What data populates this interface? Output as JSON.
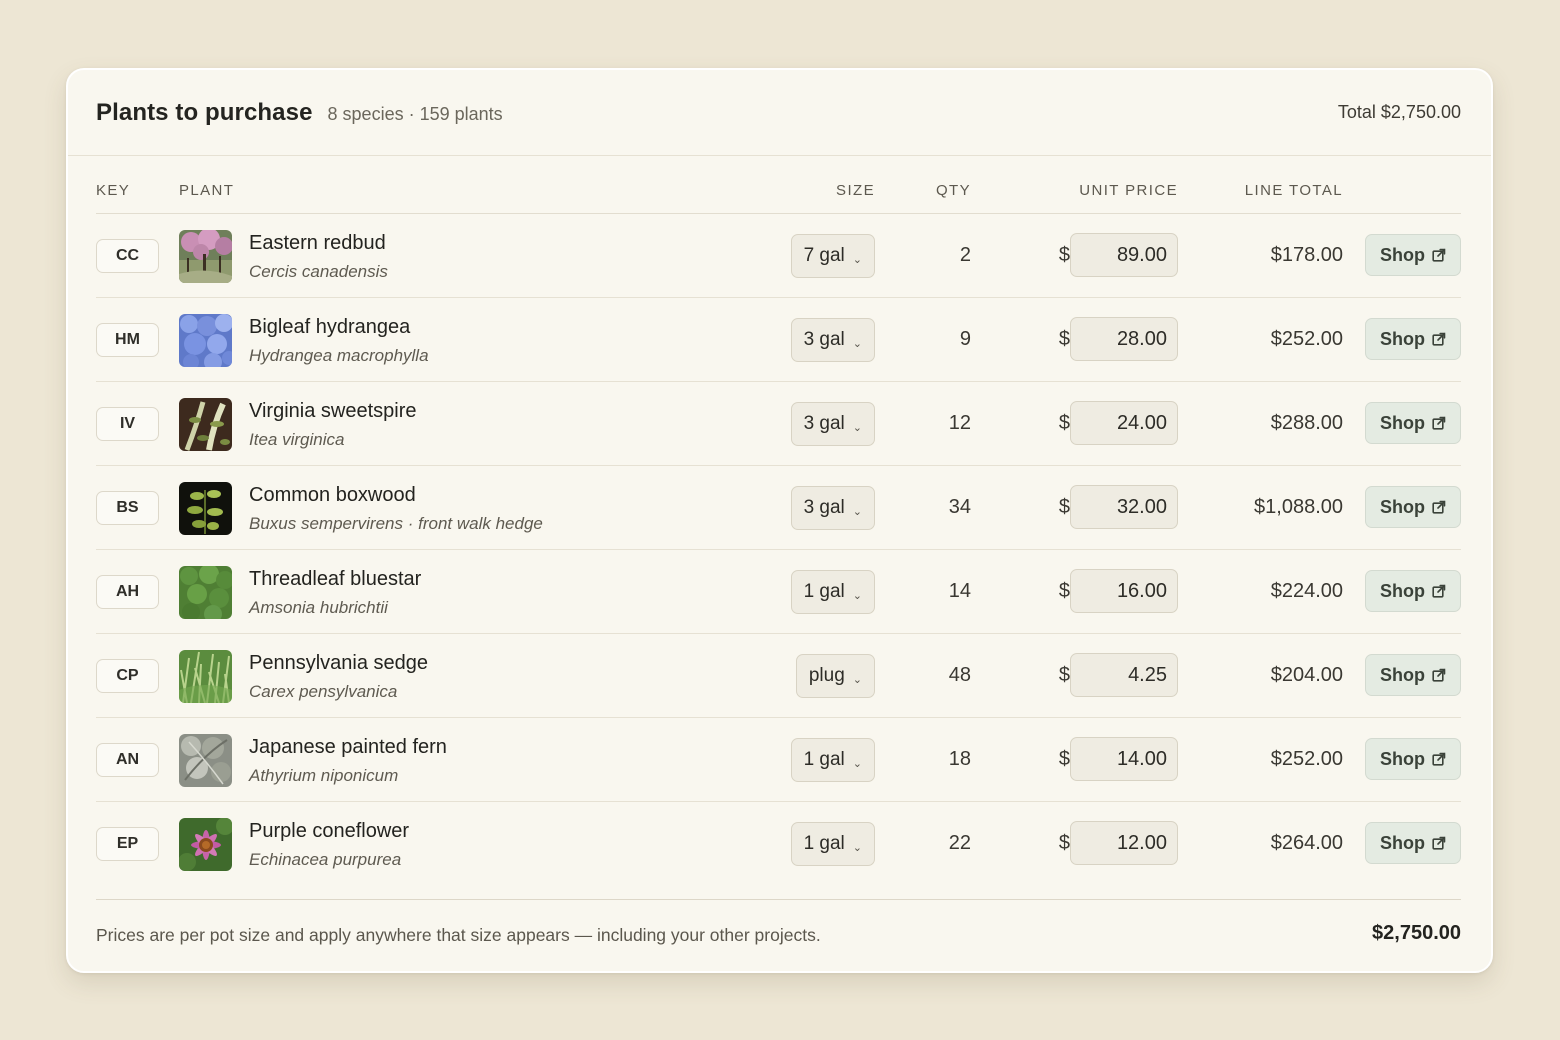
{
  "header": {
    "title": "Plants to purchase",
    "subtitle": "8 species · 159 plants",
    "total": "Total $2,750.00"
  },
  "columns": {
    "key": "KEY",
    "plant": "PLANT",
    "size": "SIZE",
    "qty": "QTY",
    "unit_price": "UNIT PRICE",
    "line_total": "LINE TOTAL"
  },
  "currency_symbol": "$",
  "shop_label": "Shop",
  "rows": [
    {
      "key": "CC",
      "common": "Eastern redbud",
      "scientific": "Cercis canadensis",
      "size": "7 gal",
      "qty": "2",
      "price": "89.00",
      "line": "$178.00",
      "thumb": "redbud"
    },
    {
      "key": "HM",
      "common": "Bigleaf hydrangea",
      "scientific": "Hydrangea macrophylla",
      "size": "3 gal",
      "qty": "9",
      "price": "28.00",
      "line": "$252.00",
      "thumb": "hydrangea"
    },
    {
      "key": "IV",
      "common": "Virginia sweetspire",
      "scientific": "Itea virginica",
      "size": "3 gal",
      "qty": "12",
      "price": "24.00",
      "line": "$288.00",
      "thumb": "sweetspire"
    },
    {
      "key": "BS",
      "common": "Common boxwood",
      "scientific": "Buxus sempervirens · front walk hedge",
      "size": "3 gal",
      "qty": "34",
      "price": "32.00",
      "line": "$1,088.00",
      "thumb": "boxwood"
    },
    {
      "key": "AH",
      "common": "Threadleaf bluestar",
      "scientific": "Amsonia hubrichtii",
      "size": "1 gal",
      "qty": "14",
      "price": "16.00",
      "line": "$224.00",
      "thumb": "bluestar"
    },
    {
      "key": "CP",
      "common": "Pennsylvania sedge",
      "scientific": "Carex pensylvanica",
      "size": "plug",
      "qty": "48",
      "price": "4.25",
      "line": "$204.00",
      "thumb": "sedge"
    },
    {
      "key": "AN",
      "common": "Japanese painted fern",
      "scientific": "Athyrium niponicum",
      "size": "1 gal",
      "qty": "18",
      "price": "14.00",
      "line": "$252.00",
      "thumb": "fern"
    },
    {
      "key": "EP",
      "common": "Purple coneflower",
      "scientific": "Echinacea purpurea",
      "size": "1 gal",
      "qty": "22",
      "price": "12.00",
      "line": "$264.00",
      "thumb": "coneflower"
    }
  ],
  "footer": {
    "note": "Prices are per pot size and apply anywhere that size appears — including your other projects.",
    "grand_total": "$2,750.00"
  },
  "colors": {
    "background": "#ede6d4",
    "card": "#f9f7ef",
    "shop_button": "#e4ebe2"
  }
}
